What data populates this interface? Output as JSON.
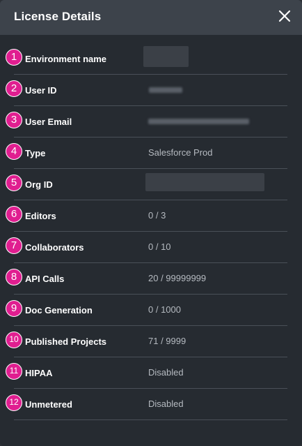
{
  "dialog": {
    "title": "License Details",
    "close_icon": "close-icon"
  },
  "rows": [
    {
      "number": "1",
      "label": "Environment name",
      "value": ""
    },
    {
      "number": "2",
      "label": "User ID",
      "value": ""
    },
    {
      "number": "3",
      "label": "User Email",
      "value": ""
    },
    {
      "number": "4",
      "label": "Type",
      "value": "Salesforce Prod"
    },
    {
      "number": "5",
      "label": "Org ID",
      "value": ""
    },
    {
      "number": "6",
      "label": "Editors",
      "value": "0 / 3"
    },
    {
      "number": "7",
      "label": "Collaborators",
      "value": "0 / 10"
    },
    {
      "number": "8",
      "label": "API Calls",
      "value": "20 / 99999999"
    },
    {
      "number": "9",
      "label": "Doc Generation",
      "value": "0 / 1000"
    },
    {
      "number": "10",
      "label": "Published Projects",
      "value": "71 / 9999"
    },
    {
      "number": "11",
      "label": "HIPAA",
      "value": "Disabled"
    },
    {
      "number": "12",
      "label": "Unmetered",
      "value": "Disabled"
    }
  ],
  "colors": {
    "badge": "#e01e90",
    "header": "#3d434b",
    "body": "#262b31"
  }
}
